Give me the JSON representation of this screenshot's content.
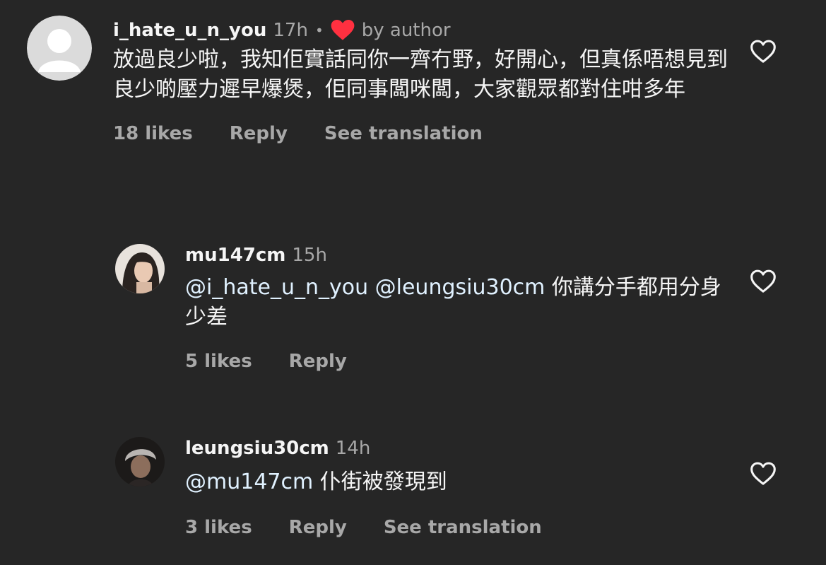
{
  "comments": [
    {
      "username": "i_hate_u_n_you",
      "time": "17h",
      "separator": "•",
      "liked_by_author_label": "by author",
      "text_mentions": "",
      "text": "放過良少啦，我知佢實話同你一齊冇野，好開心，但真係唔想見到良少啲壓力遲早爆煲，佢同事闆咪闆，大家觀眾都對住咁多年",
      "likes": "18 likes",
      "reply_label": "Reply",
      "translate_label": "See translation"
    },
    {
      "username": "mu147cm",
      "time": "15h",
      "text_mentions": "@i_hate_u_n_you @leungsiu30cm",
      "text": " 你講分手都用分身 少差",
      "likes": "5 likes",
      "reply_label": "Reply"
    },
    {
      "username": "leungsiu30cm",
      "time": "14h",
      "text_mentions": "@mu147cm",
      "text": " 仆街被發現到",
      "likes": "3 likes",
      "reply_label": "Reply",
      "translate_label": "See translation"
    }
  ],
  "colors": {
    "background": "#262626",
    "primary_text": "#f5f5f5",
    "secondary_text": "#a8a8a8",
    "mention": "#e0f1ff",
    "heart_red": "#ff3040"
  },
  "icons": {
    "like": "heart-outline-icon",
    "author_like": "heart-filled-icon",
    "default_avatar": "default-avatar-icon"
  }
}
